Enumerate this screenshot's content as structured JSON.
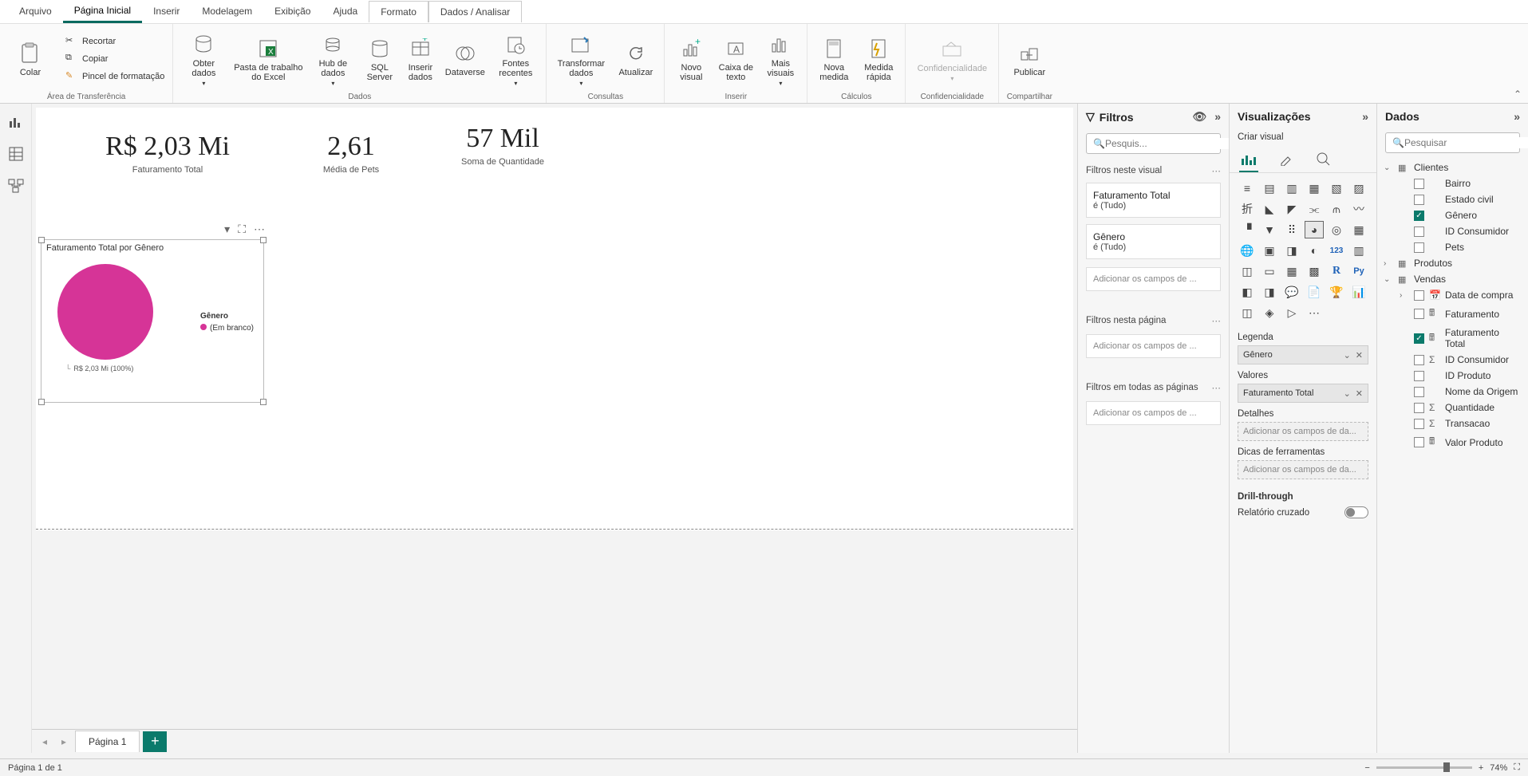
{
  "menu": {
    "arquivo": "Arquivo",
    "tabs": [
      "Página Inicial",
      "Inserir",
      "Modelagem",
      "Exibição",
      "Ajuda",
      "Formato",
      "Dados / Analisar"
    ],
    "active_index": 0
  },
  "ribbon": {
    "clipboard": {
      "paste": "Colar",
      "cut": "Recortar",
      "copy": "Copiar",
      "format_painter": "Pincel de formatação",
      "group": "Área de Transferência"
    },
    "data": {
      "get_data": "Obter dados",
      "excel": "Pasta de trabalho do Excel",
      "hub": "Hub de dados",
      "sql": "SQL Server",
      "insert_data": "Inserir dados",
      "dataverse": "Dataverse",
      "recent": "Fontes recentes",
      "group": "Dados"
    },
    "queries": {
      "transform": "Transformar dados",
      "refresh": "Atualizar",
      "group": "Consultas"
    },
    "insert": {
      "new_visual": "Novo visual",
      "text_box": "Caixa de texto",
      "more_visuals": "Mais visuais",
      "group": "Inserir"
    },
    "calc": {
      "new_measure": "Nova medida",
      "quick_measure": "Medida rápida",
      "group": "Cálculos"
    },
    "sensitivity": {
      "label": "Confidencialidade",
      "group": "Confidencialidade"
    },
    "share": {
      "publish": "Publicar",
      "group": "Compartilhar"
    }
  },
  "canvas": {
    "cards": [
      {
        "value": "R$ 2,03 Mi",
        "label": "Faturamento Total"
      },
      {
        "value": "2,61",
        "label": "Média de Pets"
      },
      {
        "value": "57 Mil",
        "label": "Soma de Quantidade"
      }
    ]
  },
  "chart_data": {
    "type": "pie",
    "title": "Faturamento Total por Gênero",
    "legend_title": "Gênero",
    "series": [
      {
        "name": "(Em branco)",
        "value": 2030000,
        "display": "R$ 2,03 Mi (100%)",
        "percent": 100,
        "color": "#d63497"
      }
    ]
  },
  "filters": {
    "title": "Filtros",
    "search_placeholder": "Pesquis...",
    "sections": {
      "visual": {
        "title": "Filtros neste visual",
        "cards": [
          {
            "name": "Faturamento Total",
            "cond": "é (Tudo)"
          },
          {
            "name": "Gênero",
            "cond": "é (Tudo)"
          }
        ],
        "placeholder": "Adicionar os campos de ..."
      },
      "page": {
        "title": "Filtros nesta página",
        "placeholder": "Adicionar os campos de ..."
      },
      "all": {
        "title": "Filtros em todas as páginas",
        "placeholder": "Adicionar os campos de ..."
      }
    }
  },
  "viz": {
    "title": "Visualizações",
    "subtitle": "Criar visual",
    "wells": {
      "legend": {
        "label": "Legenda",
        "value": "Gênero"
      },
      "values": {
        "label": "Valores",
        "value": "Faturamento Total"
      },
      "details": {
        "label": "Detalhes",
        "placeholder": "Adicionar os campos de da..."
      },
      "tooltips": {
        "label": "Dicas de ferramentas",
        "placeholder": "Adicionar os campos de da..."
      }
    },
    "drill": {
      "title": "Drill-through",
      "cross": "Relatório cruzado"
    }
  },
  "dataPane": {
    "title": "Dados",
    "search_placeholder": "Pesquisar",
    "tables": [
      {
        "name": "Clientes",
        "expanded": true,
        "fields": [
          {
            "name": "Bairro",
            "checked": false
          },
          {
            "name": "Estado civil",
            "checked": false
          },
          {
            "name": "Gênero",
            "checked": true
          },
          {
            "name": "ID Consumidor",
            "checked": false
          },
          {
            "name": "Pets",
            "checked": false
          }
        ]
      },
      {
        "name": "Produtos",
        "expanded": false,
        "fields": []
      },
      {
        "name": "Vendas",
        "expanded": true,
        "fields": [
          {
            "name": "Data de compra",
            "checked": false,
            "expandable": true,
            "icon": "date"
          },
          {
            "name": "Faturamento",
            "checked": false,
            "icon": "calc"
          },
          {
            "name": "Faturamento Total",
            "checked": true,
            "icon": "calc"
          },
          {
            "name": "ID Consumidor",
            "checked": false,
            "icon": "sum"
          },
          {
            "name": "ID Produto",
            "checked": false
          },
          {
            "name": "Nome da Origem",
            "checked": false
          },
          {
            "name": "Quantidade",
            "checked": false,
            "icon": "sum"
          },
          {
            "name": "Transacao",
            "checked": false,
            "icon": "sum"
          },
          {
            "name": "Valor Produto",
            "checked": false,
            "icon": "calc"
          }
        ]
      }
    ]
  },
  "pages": {
    "tab": "Página 1"
  },
  "status": {
    "left": "Página 1 de 1",
    "zoom": "74%"
  }
}
